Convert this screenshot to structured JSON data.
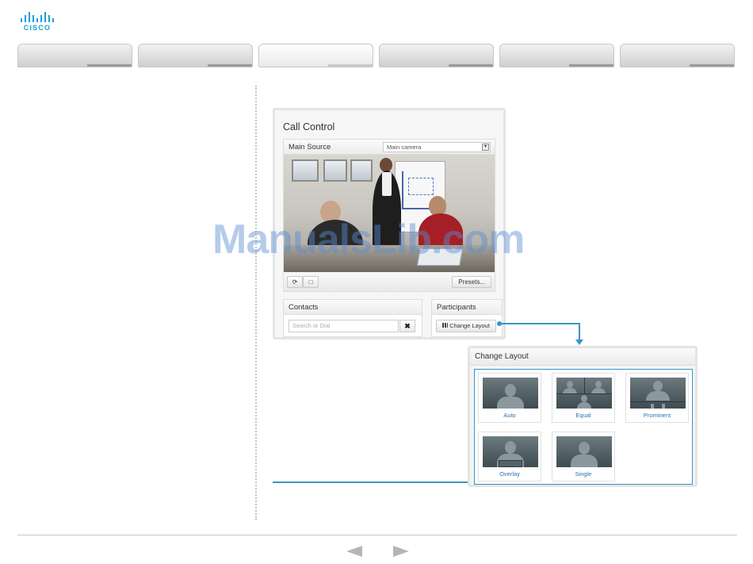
{
  "logo": {
    "text": "CISCO",
    "color": "#1ba0d7"
  },
  "tabs": [
    {
      "label": ""
    },
    {
      "label": ""
    },
    {
      "label": "",
      "active": true
    },
    {
      "label": ""
    },
    {
      "label": ""
    },
    {
      "label": ""
    }
  ],
  "call_control": {
    "title": "Call Control",
    "main_source": {
      "label": "Main Source",
      "selected": "Main camera"
    },
    "controls": {
      "refresh_icon": "refresh-icon",
      "selfview_icon": "square-icon",
      "presets_label": "Presets..."
    },
    "contacts": {
      "label": "Contacts",
      "search_placeholder": "Search or Dial",
      "clear_label": "✖"
    },
    "participants": {
      "label": "Participants",
      "change_layout_label": "Change Layout"
    }
  },
  "change_layout": {
    "title": "Change Layout",
    "options": [
      "Auto",
      "Equal",
      "Prominent",
      "Overlay",
      "Single"
    ]
  },
  "accent_color": "#3a94c7",
  "footer": {
    "prev_icon": "left-arrow-icon",
    "next_icon": "right-arrow-icon"
  },
  "watermark": "ManualsLib.com"
}
